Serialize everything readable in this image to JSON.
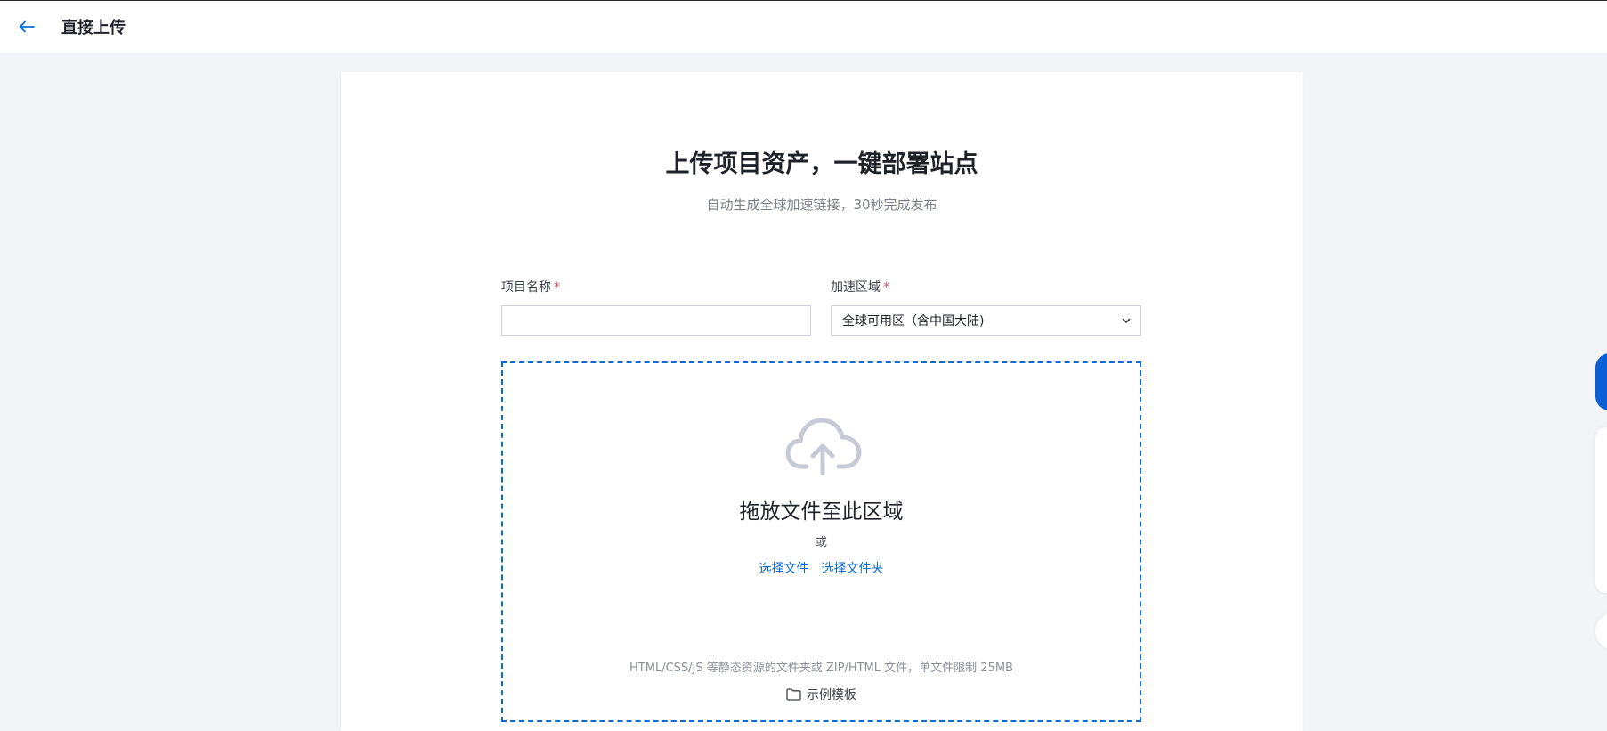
{
  "header": {
    "title": "直接上传"
  },
  "hero": {
    "title": "上传项目资产，一键部署站点",
    "subtitle": "自动生成全球加速链接，30秒完成发布"
  },
  "form": {
    "project_name_label": "项目名称",
    "project_name_value": "",
    "region_label": "加速区域",
    "region_value": "全球可用区（含中国大陆)",
    "required_mark": "*"
  },
  "upload": {
    "title": "拖放文件至此区域",
    "or_text": "或",
    "choose_file": "选择文件",
    "choose_folder": "选择文件夹",
    "hint": "HTML/CSS/JS 等静态资源的文件夹或 ZIP/HTML 文件，单文件限制 25MB",
    "template_link": "示例模板"
  },
  "icons": {
    "back": "arrow-left-icon",
    "upload": "cloud-upload-icon",
    "chevron": "chevron-down-icon",
    "folder": "folder-icon"
  },
  "colors": {
    "accent": "#0a6bd6",
    "required": "#e34d59",
    "page_bg": "#f2f4f7"
  }
}
